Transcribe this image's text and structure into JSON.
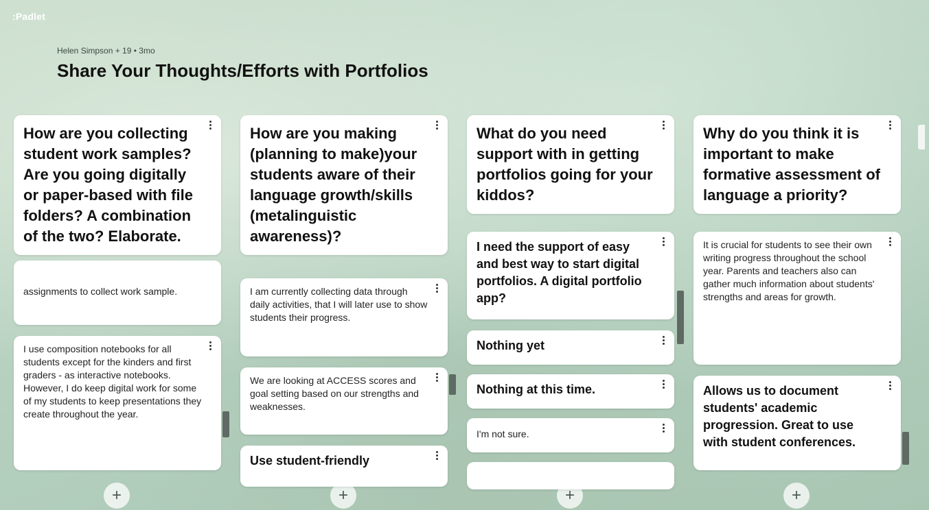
{
  "app": {
    "logo": ":Padlet"
  },
  "board": {
    "meta": "Helen Simpson + 19 • 3mo",
    "title": "Share Your Thoughts/Efforts with Portfolios"
  },
  "columns": [
    {
      "header": "How are you collecting student work samples? Are you going digitally or paper-based with file folders? A combination of the two? Elaborate.",
      "posts": [
        {
          "text": "assignments to collect work sample."
        },
        {
          "text": "I use composition notebooks for all students except for the kinders and first graders - as interactive notebooks. However, I do keep digital work for some of my students to keep presentations they create throughout the year."
        }
      ]
    },
    {
      "header": "How are you making (planning to make)your students aware of their language growth/skills (metalinguistic awareness)?",
      "posts": [
        {
          "text": "I am currently collecting data through daily activities, that I will later use to show students their progress."
        },
        {
          "text": "We are looking at ACCESS scores and goal setting based on our strengths and weaknesses."
        },
        {
          "text": "Use student-friendly"
        }
      ]
    },
    {
      "header": "What do you need support with in getting portfolios going for your kiddos?",
      "posts": [
        {
          "text": "I need the support of easy and best way to start digital portfolios. A digital portfolio app?"
        },
        {
          "text": "Nothing yet"
        },
        {
          "text": "Nothing at this time."
        },
        {
          "text": "I'm not sure."
        }
      ]
    },
    {
      "header": "Why do you think it is important to make formative assessment of language a priority?",
      "posts": [
        {
          "text": "It is crucial for students to see their own writing progress throughout the school year. Parents and teachers also can gather much information about students' strengths and areas for growth."
        },
        {
          "text": "Allows us to document students' academic progression. Great to use with student conferences."
        }
      ]
    }
  ],
  "add_button_glyph": "+",
  "icons": {
    "menu": "kebab-menu-icon",
    "add": "plus-icon"
  }
}
